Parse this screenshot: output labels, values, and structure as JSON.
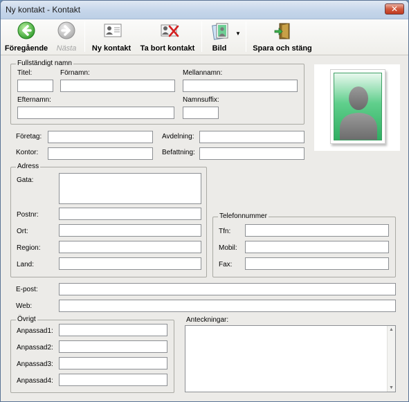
{
  "window": {
    "title": "Ny kontakt - Kontakt",
    "close_glyph": "✕"
  },
  "toolbar": {
    "previous": "Föregående",
    "next": "Nästa",
    "new_contact": "Ny kontakt",
    "delete_contact": "Ta bort kontakt",
    "picture": "Bild",
    "save_close": "Spara och stäng"
  },
  "name_group": {
    "legend": "Fullständigt namn",
    "title_label": "Titel:",
    "first_label": "Förnamn:",
    "middle_label": "Mellannamn:",
    "last_label": "Efternamn:",
    "suffix_label": "Namnsuffix:",
    "title_value": "",
    "first_value": "",
    "middle_value": "",
    "last_value": "",
    "suffix_value": ""
  },
  "org": {
    "company_label": "Företag:",
    "department_label": "Avdelning:",
    "office_label": "Kontor:",
    "jobtitle_label": "Befattning:",
    "company_value": "",
    "department_value": "",
    "office_value": "",
    "jobtitle_value": ""
  },
  "address": {
    "legend": "Adress",
    "street_label": "Gata:",
    "postal_label": "Postnr:",
    "city_label": "Ort:",
    "region_label": "Region:",
    "country_label": "Land:",
    "street_value": "",
    "postal_value": "",
    "city_value": "",
    "region_value": "",
    "country_value": ""
  },
  "phone": {
    "legend": "Telefonnummer",
    "phone_label": "Tfn:",
    "mobile_label": "Mobil:",
    "fax_label": "Fax:",
    "phone_value": "",
    "mobile_value": "",
    "fax_value": ""
  },
  "online": {
    "email_label": "E-post:",
    "web_label": "Web:",
    "email_value": "",
    "web_value": ""
  },
  "other": {
    "legend": "Övrigt",
    "custom1_label": "Anpassad1:",
    "custom2_label": "Anpassad2:",
    "custom3_label": "Anpassad3:",
    "custom4_label": "Anpassad4:",
    "custom1_value": "",
    "custom2_value": "",
    "custom3_value": "",
    "custom4_value": ""
  },
  "notes": {
    "label": "Anteckningar:",
    "value": ""
  },
  "icons": {
    "previous": "arrow-left-icon",
    "next": "arrow-right-icon",
    "new_contact": "contact-card-icon",
    "delete_contact": "delete-contact-icon",
    "picture": "picture-icon",
    "save_close": "save-door-icon",
    "photo": "person-silhouette-icon"
  },
  "colors": {
    "accent_green": "#3aa83c",
    "photo_bg": "#5fce8b",
    "delete_red": "#d42020"
  }
}
